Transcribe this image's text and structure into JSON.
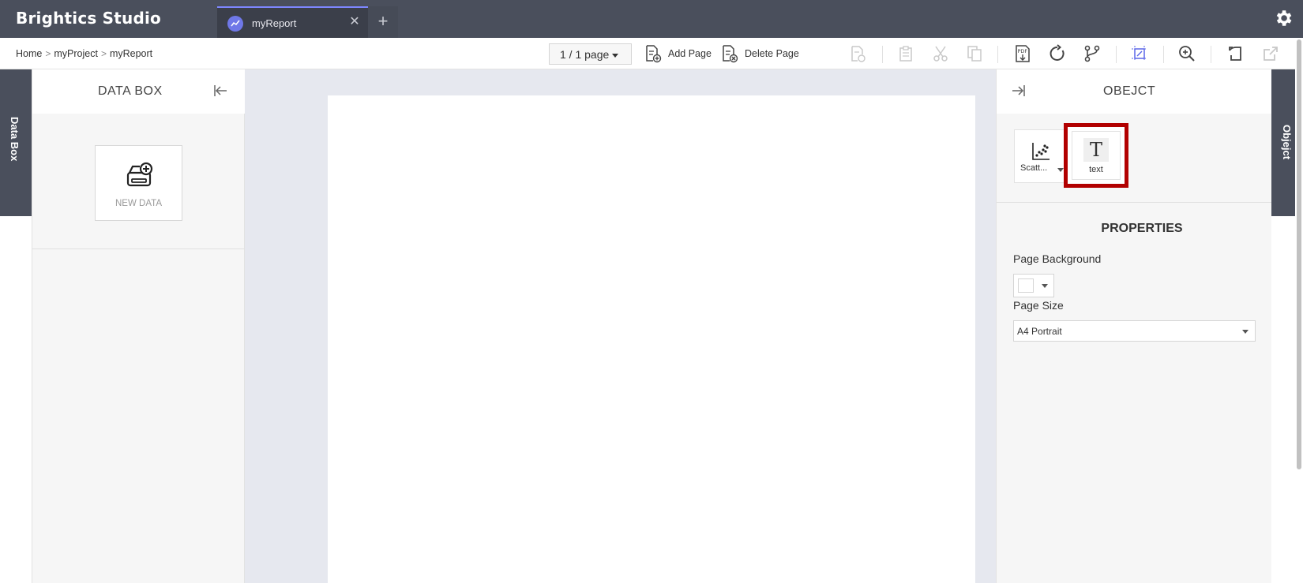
{
  "app": {
    "brand": "Brightics Studio"
  },
  "tabs": [
    {
      "label": "myReport"
    }
  ],
  "breadcrumb": {
    "items": [
      "Home",
      "myProject",
      "myReport"
    ]
  },
  "toolbar": {
    "page_selector": "1 / 1 page",
    "add_page": "Add Page",
    "delete_page": "Delete Page"
  },
  "side_tabs": {
    "left": "Data Box",
    "right": "Objejct"
  },
  "databox": {
    "title": "DATA BOX",
    "new_data": "NEW DATA"
  },
  "object_panel": {
    "title": "OBEJCT",
    "tiles": [
      {
        "label": "Scatt..."
      },
      {
        "label": "text"
      }
    ]
  },
  "properties": {
    "title": "PROPERTIES",
    "page_background_label": "Page Background",
    "page_background_color": "#ffffff",
    "page_size_label": "Page Size",
    "page_size_value": "A4 Portrait"
  },
  "colors": {
    "topbar": "#4a4f5c",
    "accent": "#7d86ff",
    "highlight": "#b20000"
  }
}
